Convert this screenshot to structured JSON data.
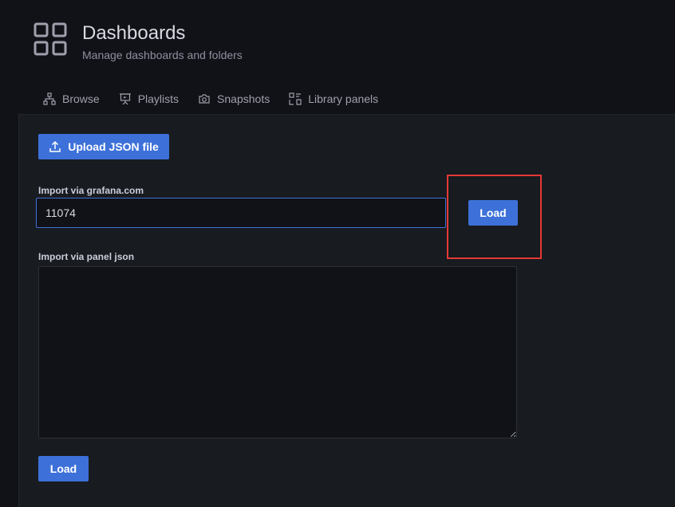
{
  "header": {
    "icon": "dashboards-grid-icon",
    "title": "Dashboards",
    "subtitle": "Manage dashboards and folders"
  },
  "tabs": [
    {
      "label": "Browse",
      "icon": "sitemap-icon"
    },
    {
      "label": "Playlists",
      "icon": "presentation-icon"
    },
    {
      "label": "Snapshots",
      "icon": "camera-icon"
    },
    {
      "label": "Library panels",
      "icon": "library-panel-icon"
    }
  ],
  "import": {
    "upload_label": "Upload JSON file",
    "grafana_label": "Import via grafana.com",
    "grafana_value": "11074",
    "load_label": "Load",
    "json_label": "Import via panel json",
    "json_value": "",
    "load_bottom_label": "Load"
  },
  "colors": {
    "background": "#111217",
    "panel": "#181b1f",
    "primary": "#3d71d9",
    "highlight": "#e53935"
  }
}
